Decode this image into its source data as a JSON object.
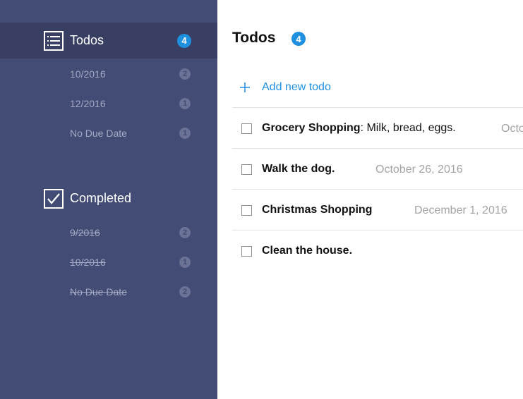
{
  "sidebar": {
    "todos": {
      "label": "Todos",
      "count": "4",
      "groups": [
        {
          "label": "10/2016",
          "count": "2"
        },
        {
          "label": "12/2016",
          "count": "1"
        },
        {
          "label": "No Due Date",
          "count": "1"
        }
      ]
    },
    "completed": {
      "label": "Completed",
      "groups": [
        {
          "label": "9/2016",
          "count": "2"
        },
        {
          "label": "10/2016",
          "count": "1"
        },
        {
          "label": "No Due Date",
          "count": "2"
        }
      ]
    }
  },
  "main": {
    "title": "Todos",
    "count": "4",
    "add_label": "Add new todo",
    "todos": [
      {
        "title": "Grocery Shopping",
        "description": ": Milk, bread, eggs.",
        "date": "Octo"
      },
      {
        "title": "Walk the dog.",
        "description": "",
        "date": "October 26, 2016"
      },
      {
        "title": "Christmas Shopping",
        "description": "",
        "date": "December 1, 2016"
      },
      {
        "title": "Clean the house.",
        "description": "",
        "date": ""
      }
    ]
  },
  "colors": {
    "sidebar_bg": "#424c75",
    "sidebar_active": "#383f62",
    "accent": "#1f8fe0"
  },
  "icons": {
    "todos": "list-icon",
    "completed": "checkbox-checked-icon",
    "add": "plus-icon",
    "todo_checkbox": "checkbox-icon"
  }
}
